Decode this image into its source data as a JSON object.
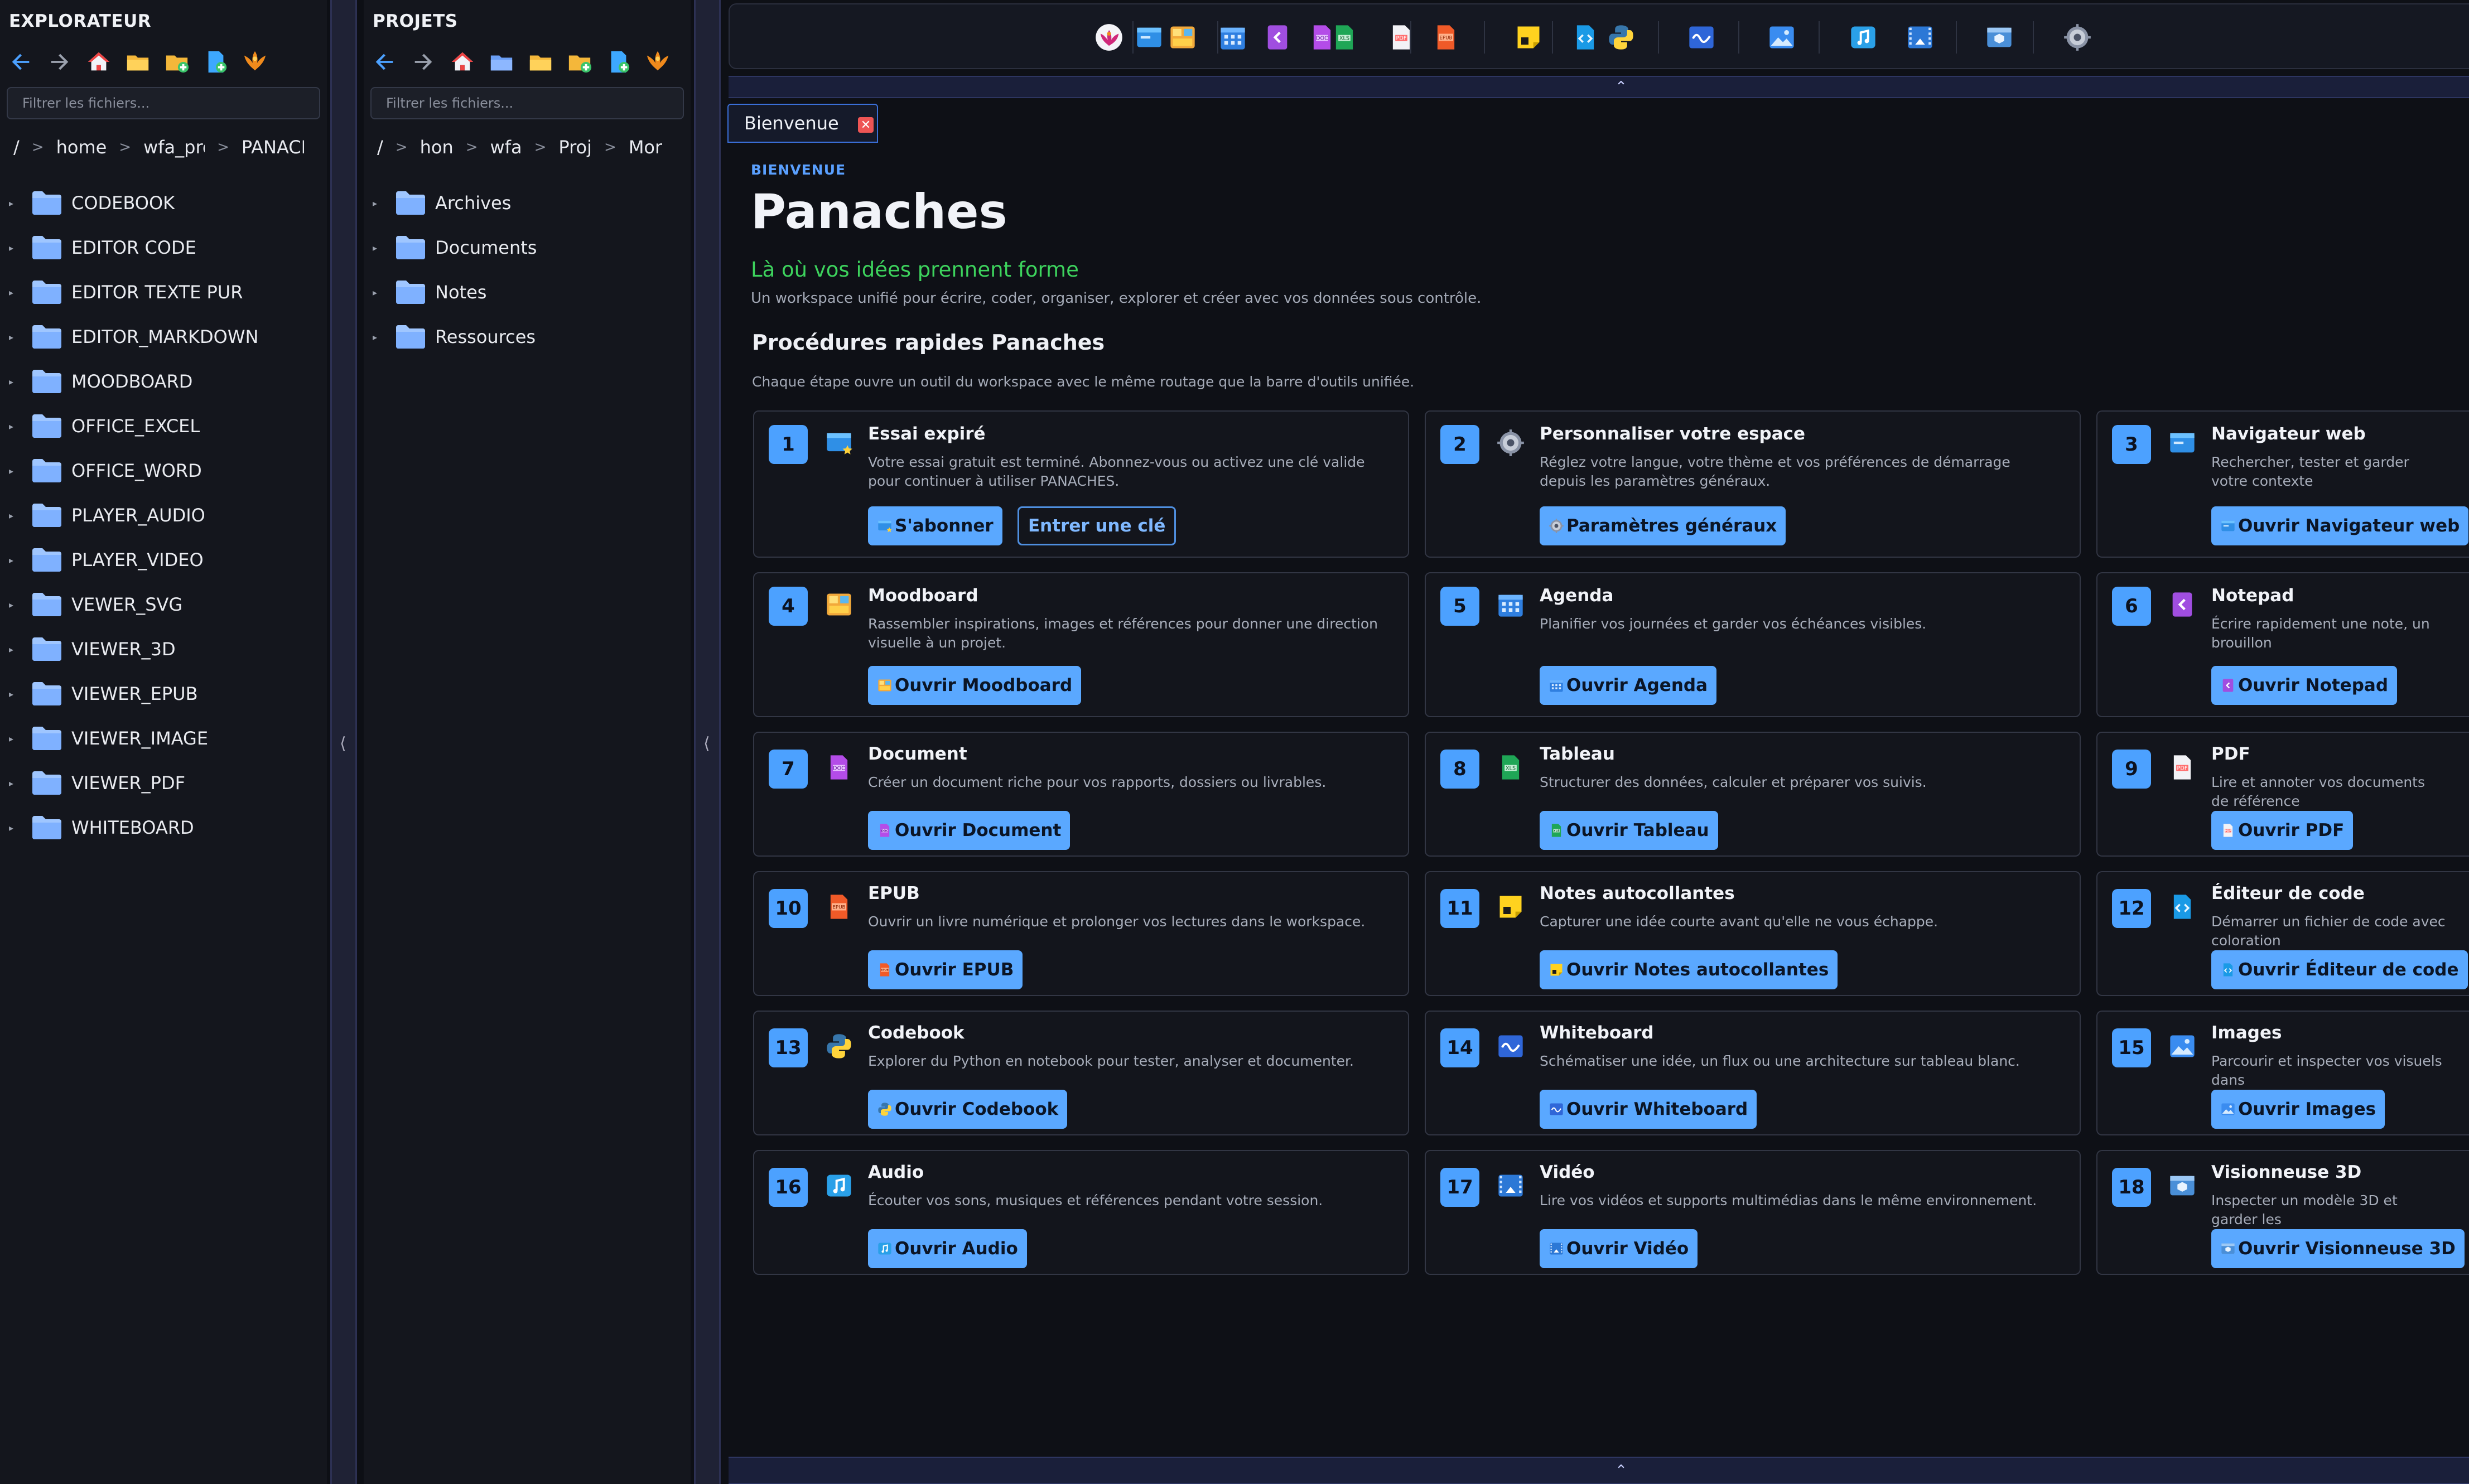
{
  "explorer": {
    "title": "EXPLORATEUR",
    "filter_placeholder": "Filtrer les fichiers...",
    "breadcrumb": [
      "/",
      "home",
      "wfa_pro",
      "PANACHES"
    ],
    "items": [
      "CODEBOOK",
      "EDITOR CODE",
      "EDITOR TEXTE PUR",
      "EDITOR_MARKDOWN",
      "MOODBOARD",
      "OFFICE_EXCEL",
      "OFFICE_WORD",
      "PLAYER_AUDIO",
      "PLAYER_VIDEO",
      "VEWER_SVG",
      "VIEWER_3D",
      "VIEWER_EPUB",
      "VIEWER_IMAGE",
      "VIEWER_PDF",
      "WHITEBOARD"
    ]
  },
  "projects": {
    "title": "PROJETS",
    "filter_placeholder": "Filtrer les fichiers...",
    "breadcrumb": [
      "/",
      "hon",
      "wfa",
      "Proj",
      "Mor"
    ],
    "items": [
      "Archives",
      "Documents",
      "Notes",
      "Ressources"
    ]
  },
  "splitters": {
    "chevron": "⟨",
    "grip": "⋮"
  },
  "toolbar_icons": [
    "panaches-logo-icon",
    "browser-icon",
    "moodboard-icon",
    "agenda-icon",
    "notepad-icon",
    "document-icon",
    "spreadsheet-icon",
    "pdf-icon",
    "epub-icon",
    "sticky-note-icon",
    "code-editor-icon",
    "python-icon",
    "whiteboard-icon",
    "image-icon",
    "audio-icon",
    "video-icon",
    "viewer-3d-icon",
    "settings-icon"
  ],
  "collapse": {
    "up_arrow": "⌃"
  },
  "tab": {
    "label": "Bienvenue",
    "close": "✕"
  },
  "welcome": {
    "eyebrow": "BIENVENUE",
    "title": "Panaches",
    "tagline": "Là où vos idées prennent forme",
    "description": "Un workspace unifié pour écrire, coder, organiser, explorer et créer avec vos données sous contrôle.",
    "section_title": "Procédures rapides Panaches",
    "section_desc": "Chaque étape ouvre un outil du workspace avec le même routage que la barre d'outils unifiée."
  },
  "cards": [
    {
      "num": "1",
      "title": "Essai expiré",
      "desc": "Votre essai gratuit est terminé. Abonnez-vous ou activez une clé valide pour continuer à utiliser PANACHES.",
      "buttons": [
        "S'abonner",
        "Entrer une clé"
      ],
      "icon": "browser-star-icon"
    },
    {
      "num": "2",
      "title": "Personnaliser votre espace",
      "desc": "Réglez votre langue, votre thème et vos préférences de démarrage depuis les paramètres généraux.",
      "buttons": [
        "Paramètres généraux"
      ],
      "icon": "settings-icon"
    },
    {
      "num": "3",
      "title": "Navigateur web",
      "desc": "Rechercher, tester et garder votre contexte",
      "buttons": [
        "Ouvrir Navigateur web"
      ],
      "icon": "browser-icon"
    },
    {
      "num": "4",
      "title": "Moodboard",
      "desc": "Rassembler inspirations, images et références pour donner une direction visuelle à un projet.",
      "buttons": [
        "Ouvrir Moodboard"
      ],
      "icon": "moodboard-icon"
    },
    {
      "num": "5",
      "title": "Agenda",
      "desc": "Planifier vos journées et garder vos échéances visibles.",
      "buttons": [
        "Ouvrir Agenda"
      ],
      "icon": "agenda-icon"
    },
    {
      "num": "6",
      "title": "Notepad",
      "desc": "Écrire rapidement une note, un brouillon",
      "buttons": [
        "Ouvrir Notepad"
      ],
      "icon": "notepad-icon"
    },
    {
      "num": "7",
      "title": "Document",
      "desc": "Créer un document riche pour vos rapports, dossiers ou livrables.",
      "buttons": [
        "Ouvrir Document"
      ],
      "icon": "document-icon"
    },
    {
      "num": "8",
      "title": "Tableau",
      "desc": "Structurer des données, calculer et préparer vos suivis.",
      "buttons": [
        "Ouvrir Tableau"
      ],
      "icon": "spreadsheet-icon"
    },
    {
      "num": "9",
      "title": "PDF",
      "desc": "Lire et annoter vos documents de référence",
      "buttons": [
        "Ouvrir PDF"
      ],
      "icon": "pdf-icon"
    },
    {
      "num": "10",
      "title": "EPUB",
      "desc": "Ouvrir un livre numérique et prolonger vos lectures dans le workspace.",
      "buttons": [
        "Ouvrir EPUB"
      ],
      "icon": "epub-icon"
    },
    {
      "num": "11",
      "title": "Notes autocollantes",
      "desc": "Capturer une idée courte avant qu'elle ne vous échappe.",
      "buttons": [
        "Ouvrir Notes autocollantes"
      ],
      "icon": "sticky-note-icon"
    },
    {
      "num": "12",
      "title": "Éditeur de code",
      "desc": "Démarrer un fichier de code avec coloration",
      "buttons": [
        "Ouvrir Éditeur de code"
      ],
      "icon": "code-editor-icon"
    },
    {
      "num": "13",
      "title": "Codebook",
      "desc": "Explorer du Python en notebook pour tester, analyser et documenter.",
      "buttons": [
        "Ouvrir Codebook"
      ],
      "icon": "python-icon"
    },
    {
      "num": "14",
      "title": "Whiteboard",
      "desc": "Schématiser une idée, un flux ou une architecture sur tableau blanc.",
      "buttons": [
        "Ouvrir Whiteboard"
      ],
      "icon": "whiteboard-icon"
    },
    {
      "num": "15",
      "title": "Images",
      "desc": "Parcourir et inspecter vos visuels dans",
      "buttons": [
        "Ouvrir Images"
      ],
      "icon": "image-icon"
    },
    {
      "num": "16",
      "title": "Audio",
      "desc": "Écouter vos sons, musiques et références pendant votre session.",
      "buttons": [
        "Ouvrir Audio"
      ],
      "icon": "audio-icon"
    },
    {
      "num": "17",
      "title": "Vidéo",
      "desc": "Lire vos vidéos et supports multimédias dans le même environnement.",
      "buttons": [
        "Ouvrir Vidéo"
      ],
      "icon": "video-icon"
    },
    {
      "num": "18",
      "title": "Visionneuse 3D",
      "desc": "Inspecter un modèle 3D et garder les",
      "buttons": [
        "Ouvrir Visionneuse 3D"
      ],
      "icon": "viewer-3d-icon"
    }
  ],
  "colors": {
    "accent": "#4ca1ff",
    "tagline": "#3dd35d",
    "background": "#0e1016",
    "panel": "#14161d"
  }
}
